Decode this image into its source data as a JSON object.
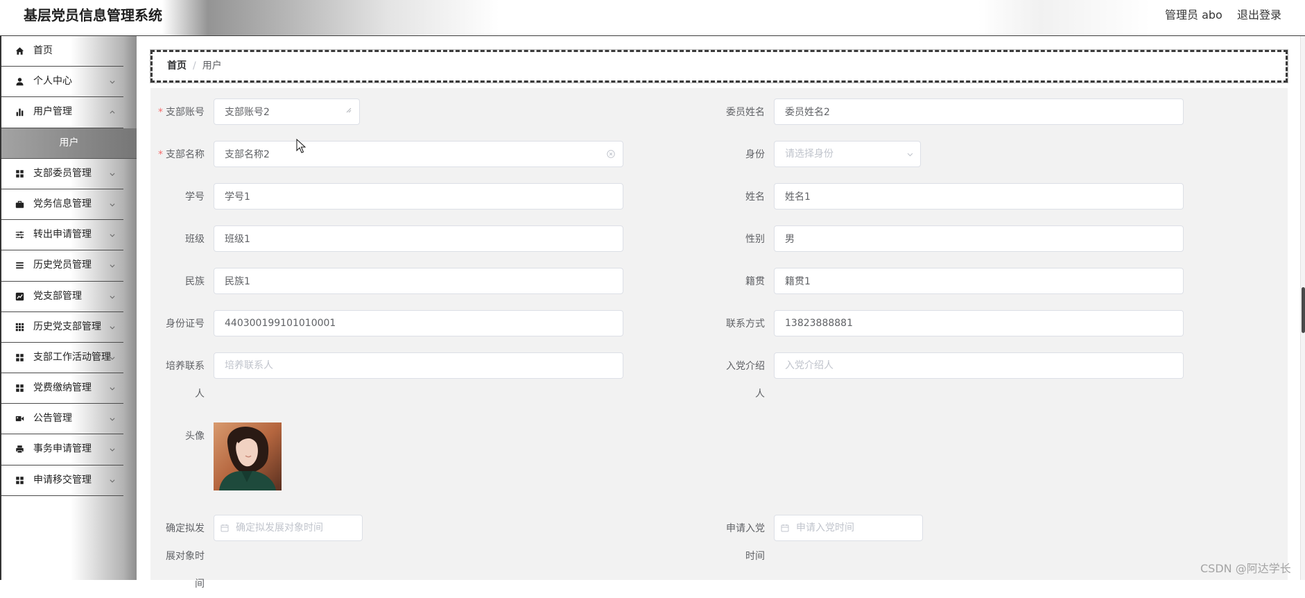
{
  "header": {
    "title": "基层党员信息管理系统",
    "admin_label": "管理员 abo",
    "logout_label": "退出登录"
  },
  "sidebar": {
    "items": [
      {
        "label": "首页",
        "icon": "home-icon"
      },
      {
        "label": "个人中心",
        "icon": "user-icon"
      },
      {
        "label": "用户管理",
        "icon": "bar-chart-icon"
      },
      {
        "label": "用户",
        "active": true
      },
      {
        "label": "支部委员管理",
        "icon": "grid-icon"
      },
      {
        "label": "党务信息管理",
        "icon": "briefcase-icon"
      },
      {
        "label": "转出申请管理",
        "icon": "sliders-icon"
      },
      {
        "label": "历史党员管理",
        "icon": "list-icon"
      },
      {
        "label": "党支部管理",
        "icon": "line-chart-icon"
      },
      {
        "label": "历史党支部管理",
        "icon": "grid-3x3-icon"
      },
      {
        "label": "支部工作活动管理",
        "icon": "grid-icon"
      },
      {
        "label": "党费缴纳管理",
        "icon": "grid-icon"
      },
      {
        "label": "公告管理",
        "icon": "ticket-icon"
      },
      {
        "label": "事务申请管理",
        "icon": "printer-icon"
      },
      {
        "label": "申请移交管理",
        "icon": "grid-icon"
      }
    ]
  },
  "breadcrumb": {
    "home": "首页",
    "separator": "/",
    "current": "用户"
  },
  "form": {
    "required_mark": "*",
    "fields": {
      "branch_account": {
        "label": "支部账号",
        "value": "支部账号2",
        "required": true
      },
      "committee_name": {
        "label": "委员姓名",
        "value": "委员姓名2"
      },
      "branch_name": {
        "label": "支部名称",
        "value": "支部名称2",
        "required": true
      },
      "identity": {
        "label": "身份",
        "placeholder": "请选择身份"
      },
      "student_no": {
        "label": "学号",
        "value": "学号1"
      },
      "name": {
        "label": "姓名",
        "value": "姓名1"
      },
      "class_name": {
        "label": "班级",
        "value": "班级1"
      },
      "gender": {
        "label": "性别",
        "value": "男"
      },
      "ethnicity": {
        "label": "民族",
        "value": "民族1"
      },
      "native_place": {
        "label": "籍贯",
        "value": "籍贯1"
      },
      "id_number": {
        "label": "身份证号",
        "value": "440300199101010001"
      },
      "contact": {
        "label": "联系方式",
        "value": "13823888881"
      },
      "training_contact": {
        "label": "培养联系人",
        "placeholder": "培养联系人"
      },
      "introducer": {
        "label": "入党介绍人",
        "placeholder": "入党介绍人"
      },
      "avatar": {
        "label": "头像"
      },
      "candidate_date": {
        "label": "确定拟发展对象时间",
        "placeholder": "确定拟发展对象时间"
      },
      "apply_date": {
        "label": "申请入党时间",
        "placeholder": "申请入党时间"
      }
    }
  },
  "watermark": "CSDN @阿达学长",
  "colors": {
    "required": "#f56c6c",
    "active_menu": "#7d7d7d",
    "form_background": "#f2f2f2",
    "input_border": "#dcdfe6"
  }
}
